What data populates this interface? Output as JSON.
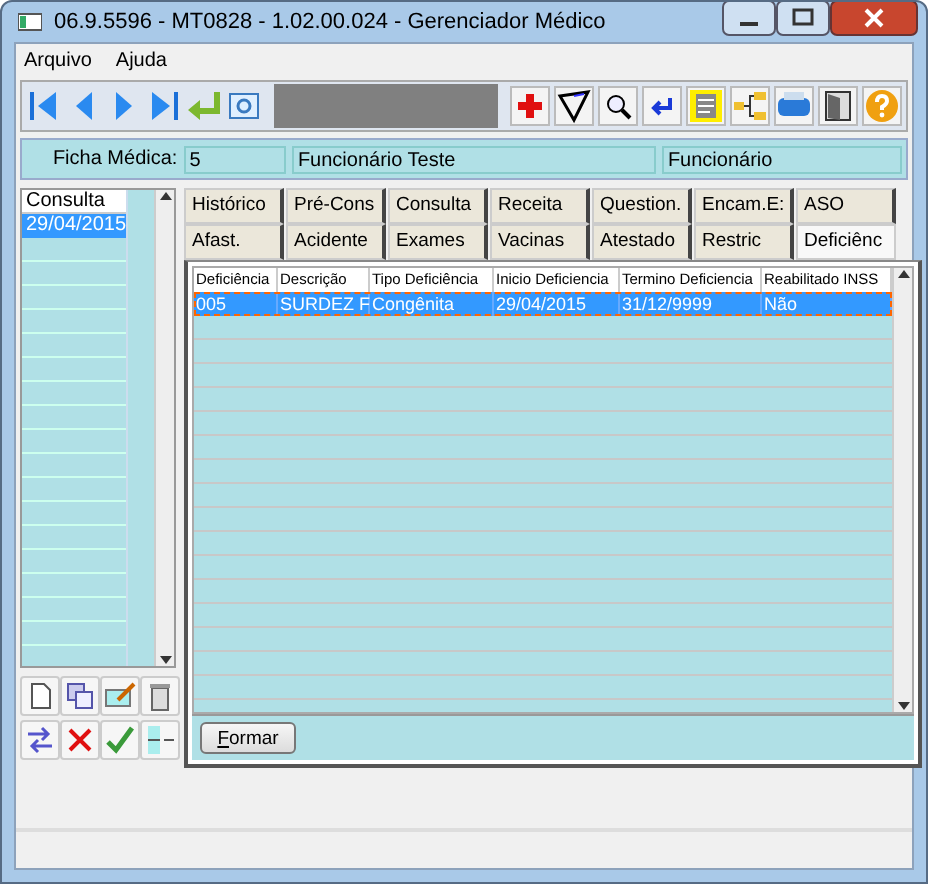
{
  "window": {
    "title": "06.9.5596 - MT0828 - 1.02.00.024 - Gerenciador Médico"
  },
  "menu": [
    "Arquivo",
    "Ajuda"
  ],
  "info": {
    "label": "Ficha Médica:",
    "fields": [
      "5",
      "Funcionário Teste",
      "Funcionário"
    ]
  },
  "consultas": {
    "header": "Consulta",
    "rows": [
      {
        "text": "29/04/2015",
        "selected": true
      }
    ]
  },
  "tabs": [
    [
      {
        "label": "Histórico",
        "selected": false
      },
      {
        "label": "Pré-Cons",
        "selected": false
      },
      {
        "label": "Consulta",
        "selected": false
      },
      {
        "label": "Receita",
        "selected": false
      },
      {
        "label": "Question.",
        "selected": false
      },
      {
        "label": "Encam.E:",
        "selected": false
      },
      {
        "label": "ASO",
        "selected": false
      }
    ],
    [
      {
        "label": "Afast.",
        "selected": false
      },
      {
        "label": "Acidente",
        "selected": false
      },
      {
        "label": "Exames",
        "selected": false
      },
      {
        "label": "Vacinas",
        "selected": false
      },
      {
        "label": "Atestado",
        "selected": false
      },
      {
        "label": "Restric",
        "selected": false
      },
      {
        "label": "Deficiênc",
        "selected": true
      }
    ]
  ],
  "table": {
    "columns": [
      "Deficiência",
      "Descrição",
      "Tipo Deficiência",
      "Inicio Deficiencia",
      "Termino Deficiencia",
      "Reabilitado INSS"
    ],
    "rows": [
      {
        "cells": [
          "005",
          "SURDEZ F",
          "Congênita",
          "29/04/2015",
          "31/12/9999",
          "Não"
        ],
        "selected": true
      }
    ]
  },
  "button": "Formar"
}
